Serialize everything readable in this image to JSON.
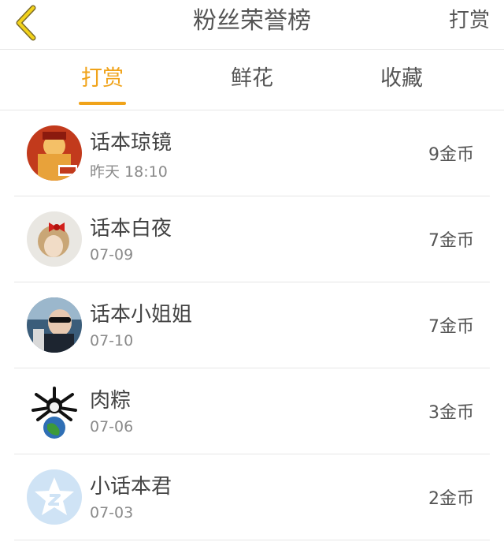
{
  "header": {
    "title": "粉丝荣誉榜",
    "action": "打赏",
    "accent": "#f0a31a"
  },
  "tabs": [
    {
      "label": "打赏",
      "active": true
    },
    {
      "label": "鲜花",
      "active": false
    },
    {
      "label": "收藏",
      "active": false
    }
  ],
  "rows": [
    {
      "name": "话本琼镜",
      "time": "昨天 18:10",
      "amount": "9金币",
      "avatar_icon": "red-costume-avatar"
    },
    {
      "name": "话本白夜",
      "time": "07-09",
      "amount": "7金币",
      "avatar_icon": "girl-red-bow-avatar"
    },
    {
      "name": "话本小姐姐",
      "time": "07-10",
      "amount": "7金币",
      "avatar_icon": "sunglasses-person-avatar"
    },
    {
      "name": "肉粽",
      "time": "07-06",
      "amount": "3金币",
      "avatar_icon": "cartoon-globe-avatar"
    },
    {
      "name": "小话本君",
      "time": "07-03",
      "amount": "2金币",
      "avatar_icon": "default-star-avatar"
    }
  ]
}
